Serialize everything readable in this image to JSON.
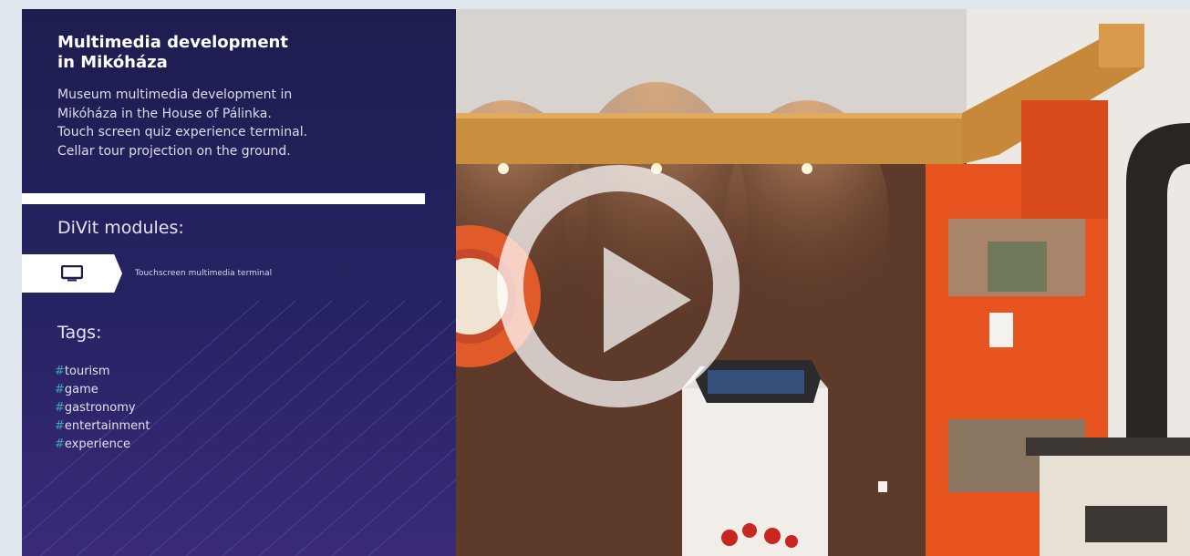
{
  "project": {
    "title_line1": "Multimedia development",
    "title_line2": "in Mikóháza",
    "description": [
      "Museum multimedia development in",
      "Mikóháza in the House of Pálinka.",
      "Touch screen quiz experience terminal.",
      "Cellar tour projection on the ground."
    ]
  },
  "modules": {
    "heading": "DiVit modules:",
    "items": [
      {
        "icon": "monitor-icon",
        "label": "Touchscreen multimedia terminal"
      }
    ]
  },
  "tags": {
    "heading": "Tags:",
    "hash": "#",
    "items": [
      "tourism",
      "game",
      "gastronomy",
      "entertainment",
      "experience"
    ]
  },
  "video": {
    "play_icon": "play-icon"
  },
  "colors": {
    "panel": "#262363",
    "tag_hash": "#3ea6b6",
    "accent_orange": "#e8541f"
  }
}
